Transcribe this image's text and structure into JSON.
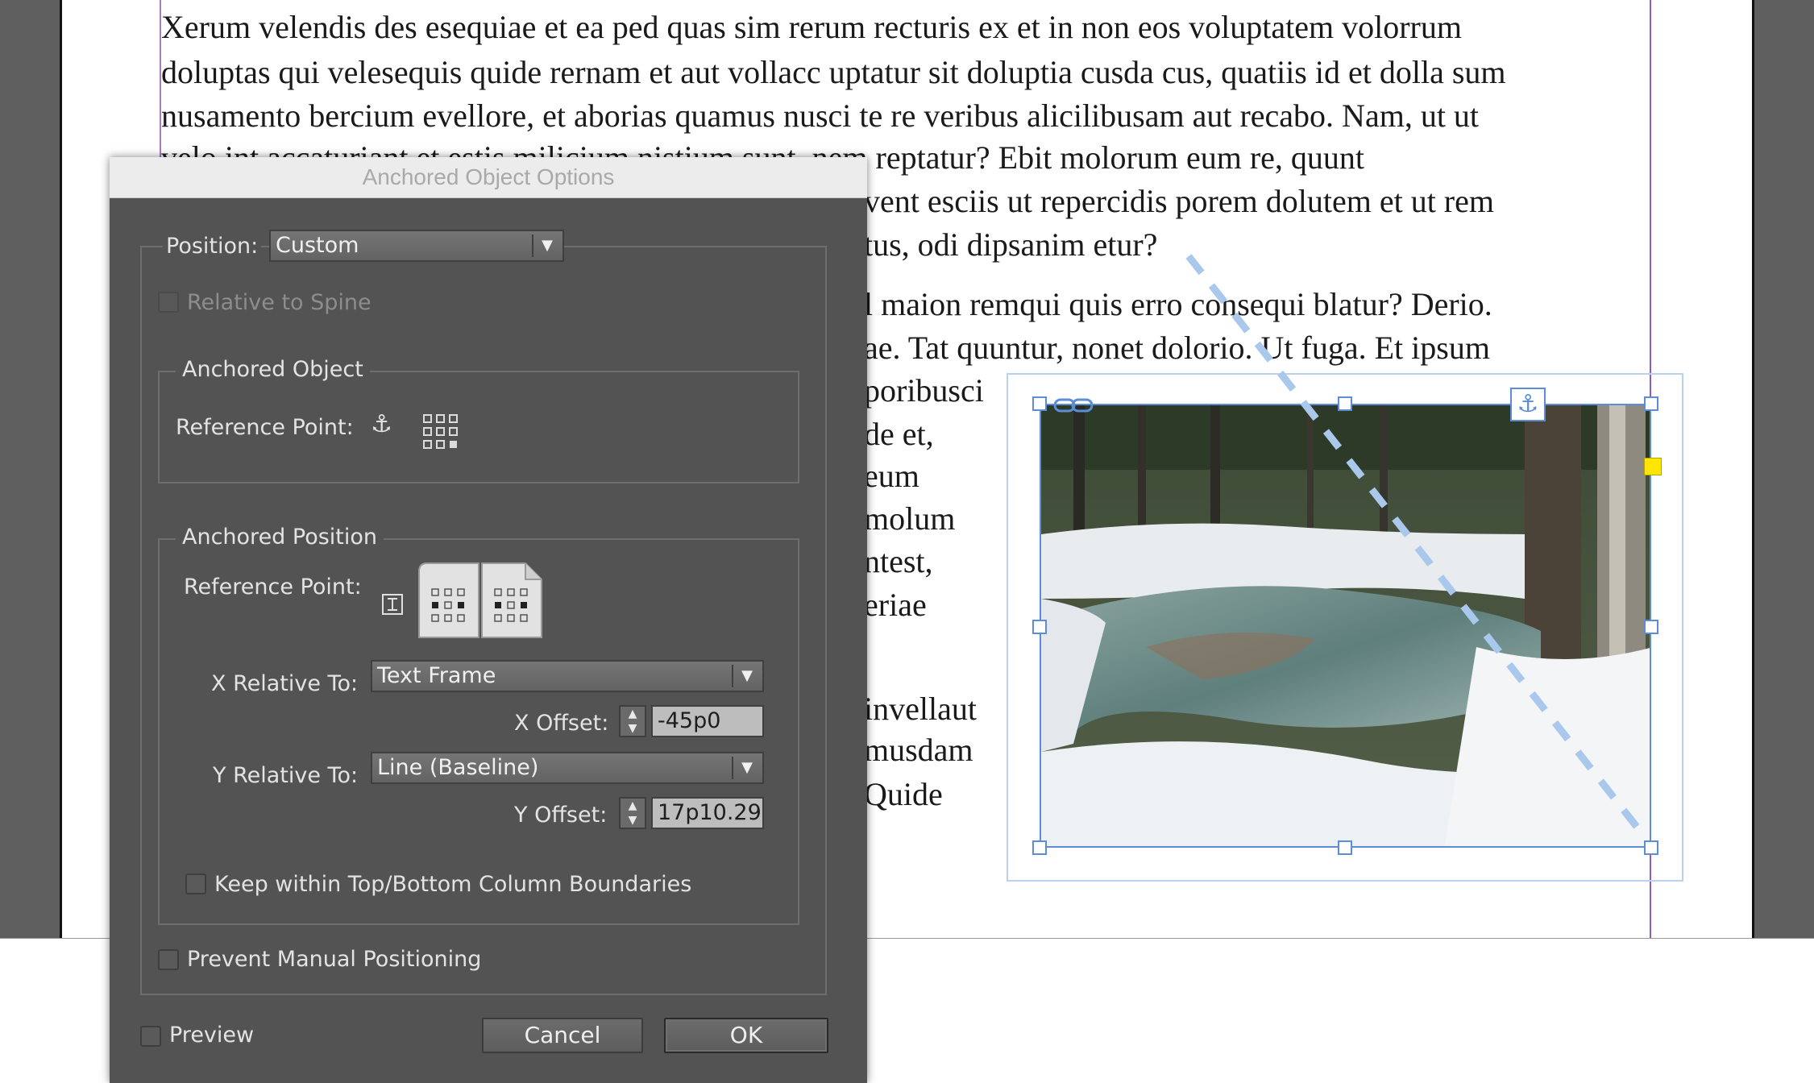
{
  "document": {
    "paragraph_lines": [
      "Xerum velendis des esequiae et ea ped quas sim rerum recturis ex et in non eos voluptatem volorrum",
      "doluptas qui velesequis quide rernam et aut vollacc uptatur sit doluptia cusda cus, quatiis id et dolla sum",
      "nusamento bercium evellore, et aborias quamus nusci te re veribus alicilibusam aut recabo. Nam, ut ut",
      "velo int accaturiant et estis milicium nistium sunt, nem reptatur? Ebit molorum eum re, quunt"
    ],
    "right_column_lines": [
      "vent esciis ut repercidis porem dolutem et ut rem",
      "tus, odi dipsanim etur?",
      "l maion remqui quis erro consequi blatur? Derio.",
      "ae. Tat quuntur, nonet dolorio. Ut fuga. Et ipsum",
      "poribusci",
      "de et,",
      "eum",
      "molum",
      "ntest,",
      "eriae",
      "invellaut",
      "musdam",
      "Quide"
    ]
  },
  "dialog": {
    "title": "Anchored Object Options",
    "position_label": "Position:",
    "position_value": "Custom",
    "relative_to_spine_label": "Relative to Spine",
    "anchored_object": {
      "group_title": "Anchored Object",
      "reference_point_label": "Reference Point:"
    },
    "anchored_position": {
      "group_title": "Anchored Position",
      "reference_point_label": "Reference Point:",
      "x_relative_label": "X Relative To:",
      "x_relative_value": "Text Frame",
      "x_offset_label": "X Offset:",
      "x_offset_value": "-45p0",
      "y_relative_label": "Y Relative To:",
      "y_relative_value": "Line (Baseline)",
      "y_offset_label": "Y Offset:",
      "y_offset_value": "17p10.29",
      "keep_within_label": "Keep within Top/Bottom Column Boundaries"
    },
    "prevent_manual_label": "Prevent Manual Positioning",
    "preview_label": "Preview",
    "cancel_label": "Cancel",
    "ok_label": "OK"
  },
  "icons": {
    "anchor": "anchor-icon",
    "reference_grid": "reference-point-grid-icon",
    "spread": "spread-reference-icon",
    "link": "link-icon",
    "stepper": "stepper-arrows-icon"
  },
  "colors": {
    "selection_blue": "#5b8ed6",
    "margin_guide": "#8e5cc0",
    "dialog_bg": "#535353"
  }
}
